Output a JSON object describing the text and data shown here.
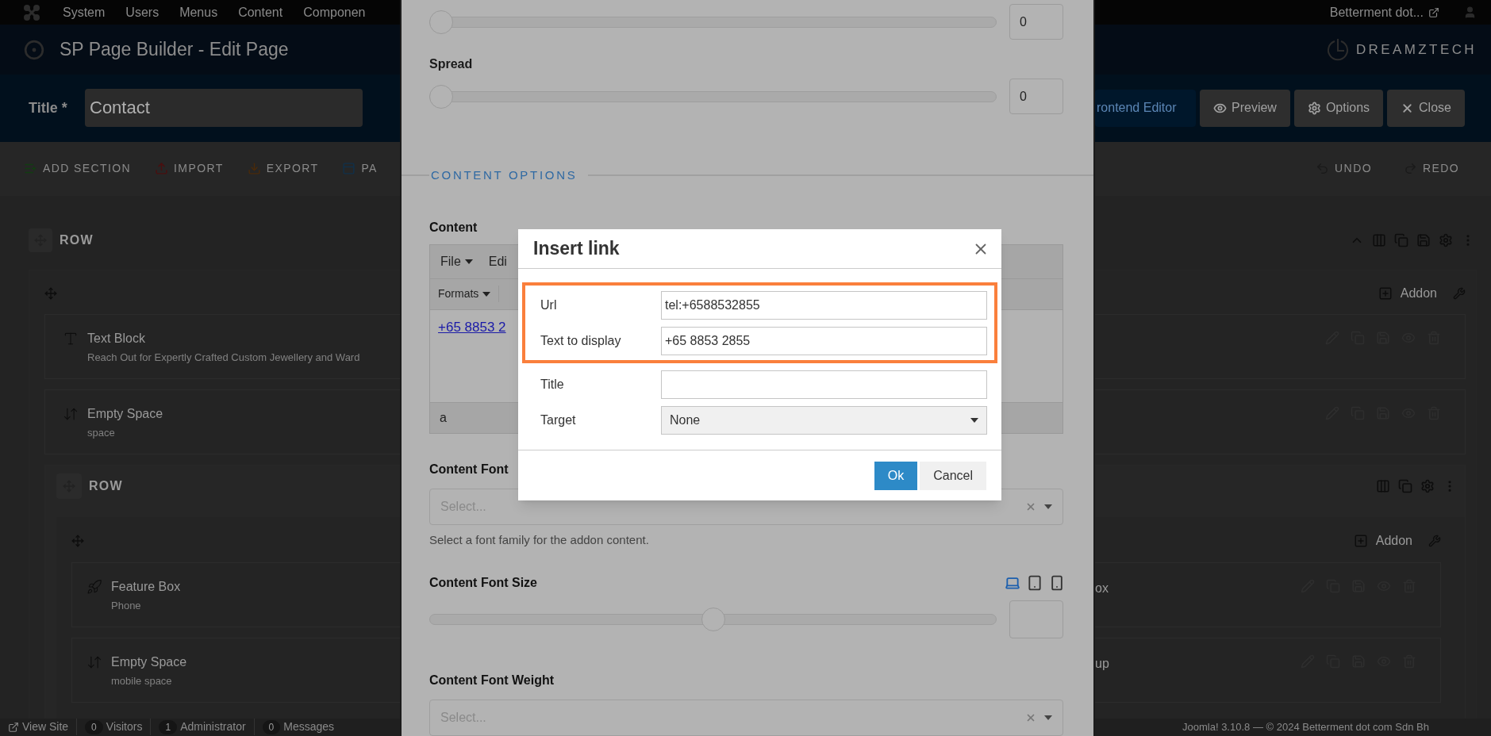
{
  "top_menu": {
    "items": [
      "System",
      "Users",
      "Menus",
      "Content",
      "Componen"
    ],
    "site_link": "Betterment dot..."
  },
  "header": {
    "title": "SP Page Builder - Edit Page",
    "logo_text": "DREAMZTECH"
  },
  "title_bar": {
    "label": "Title *",
    "value": "Contact",
    "buttons": [
      {
        "label": "rontend Editor",
        "kind": "frontend"
      },
      {
        "label": "Preview",
        "kind": "preview"
      },
      {
        "label": "Options",
        "kind": "options"
      },
      {
        "label": "Close",
        "kind": "close"
      }
    ]
  },
  "toolbar": {
    "left": [
      {
        "label": "ADD SECTION",
        "kind": "add"
      },
      {
        "label": "IMPORT",
        "kind": "import"
      },
      {
        "label": "EXPORT",
        "kind": "export"
      },
      {
        "label": "PA",
        "kind": "pages"
      }
    ],
    "right": [
      {
        "label": "UNDO",
        "kind": "undo"
      },
      {
        "label": "REDO",
        "kind": "redo"
      }
    ]
  },
  "builder": {
    "row_label": "ROW",
    "addon_label": "Addon",
    "addons": [
      {
        "title": "Text Block",
        "subtitle": "Reach Out for Expertly Crafted Custom Jewellery and Ward",
        "kind": "text"
      },
      {
        "title": "Empty Space",
        "subtitle": "space",
        "kind": "space"
      }
    ],
    "inner_row": {
      "row_label": "ROW",
      "addon_label": "Addon",
      "addons": [
        {
          "title": "Feature Box",
          "subtitle": "Phone",
          "kind": "feature"
        },
        {
          "title": "Empty Space",
          "subtitle": "mobile space",
          "kind": "space"
        }
      ],
      "right_addons": [
        "ox",
        "up"
      ]
    }
  },
  "panel": {
    "top_slider": {
      "level": 0,
      "value": "0"
    },
    "spread": {
      "label": "Spread",
      "level": 0,
      "value": "0"
    },
    "section_title": "CONTENT OPTIONS",
    "content": {
      "label": "Content",
      "menus": [
        {
          "label": "File",
          "caret": true
        },
        {
          "label": "Edi",
          "caret": false
        }
      ],
      "formats": {
        "label": "Formats",
        "caret": true
      },
      "link": "+65 8853 2",
      "path": "a"
    },
    "font_family": {
      "label": "Content Font",
      "placeholder": "Select...",
      "help": "Select a font family for the addon content."
    },
    "font_size": {
      "label": "Content Font Size",
      "level": 0.5,
      "devices": [
        {
          "kind": "desktop",
          "selected": true
        },
        {
          "kind": "tablet",
          "selected": false
        },
        {
          "kind": "mobile",
          "selected": false
        }
      ]
    },
    "font_weight": {
      "label": "Content Font Weight",
      "placeholder": "Select..."
    }
  },
  "modal": {
    "title": "Insert link",
    "fields": [
      {
        "label": "Url",
        "value": "tel:+6588532855",
        "kind": "text",
        "highlighted": true
      },
      {
        "label": "Text to display",
        "value": "+65 8853 2855",
        "kind": "text",
        "highlighted": true
      },
      {
        "label": "Title",
        "kind": "text",
        "highlighted": false
      },
      {
        "label": "Target",
        "value": "None",
        "kind": "select",
        "highlighted": false
      }
    ],
    "buttons": [
      {
        "label": "Ok",
        "kind": "primary"
      },
      {
        "label": "Cancel",
        "kind": "secondary"
      }
    ]
  },
  "status_bar": {
    "view_site": "View Site",
    "counters": [
      {
        "count": "0",
        "label": "Visitors"
      },
      {
        "count": "1",
        "label": "Administrator"
      },
      {
        "count": "0",
        "label": "Messages"
      }
    ],
    "footer": "Joomla! 3.10.8 — © 2024 Betterment dot com Sdn Bh"
  }
}
